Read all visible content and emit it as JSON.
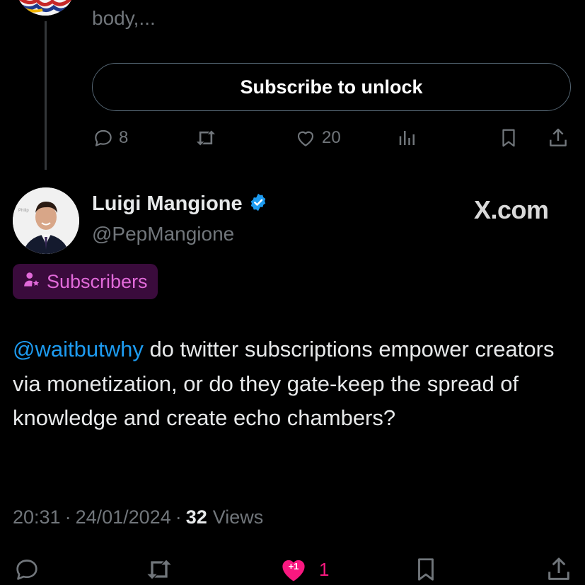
{
  "previous_post": {
    "truncated_text": "body,...",
    "subscribe_label": "Subscribe to unlock",
    "actions": {
      "replies": "8",
      "likes": "20"
    }
  },
  "post": {
    "author_name": "Luigi Mangione",
    "handle": "@PepMangione",
    "watermark": "X.com",
    "badge_label": "Subscribers",
    "mention": "@waitbutwhy",
    "text": " do twitter subscriptions empower creators via monetization, or do they gate-keep the spread of knowledge and create echo chambers?",
    "time": "20:31",
    "separator": "·",
    "date": "24/01/2024",
    "views_count": "32",
    "views_label": "Views",
    "like_bubble": "+1",
    "like_count": "1"
  },
  "colors": {
    "accent_blue": "#1d9bf0",
    "like_pink": "#f91880",
    "subscriber_purple": "#e16ad9"
  },
  "icons": [
    "reply-icon",
    "retweet-icon",
    "like-icon",
    "views-icon",
    "bookmark-icon",
    "share-icon",
    "verified-badge-icon",
    "subscribers-icon"
  ]
}
